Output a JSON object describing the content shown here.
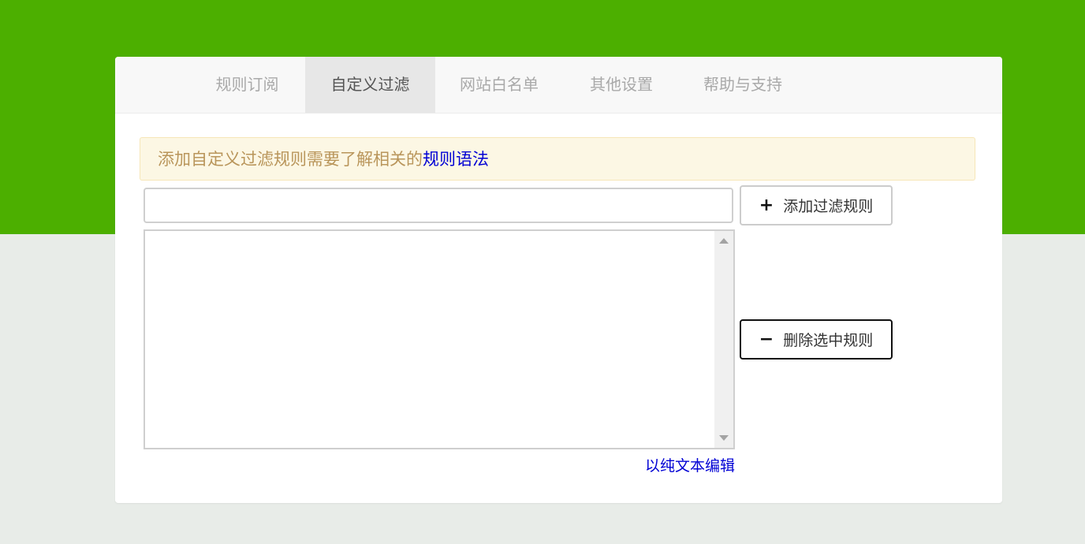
{
  "colors": {
    "header_band": "#4caf00",
    "page_background": "#e8ece8",
    "tab_active_bg": "#e7e7e7",
    "notice_bg": "#fcf7e4",
    "notice_text": "#b9955a",
    "link": "#0000d4"
  },
  "tabs": [
    {
      "label": "规则订阅",
      "active": false
    },
    {
      "label": "自定义过滤",
      "active": true
    },
    {
      "label": "网站白名单",
      "active": false
    },
    {
      "label": "其他设置",
      "active": false
    },
    {
      "label": "帮助与支持",
      "active": false
    }
  ],
  "notice": {
    "text": "添加自定义过滤规则需要了解相关的",
    "link_text": "规则语法"
  },
  "rule_input": {
    "value": "",
    "placeholder": ""
  },
  "buttons": {
    "add_icon": "plus-icon",
    "add_label": "添加过滤规则",
    "delete_icon": "minus-icon",
    "delete_label": "删除选中规则"
  },
  "rule_list": {
    "items": []
  },
  "plain_text_edit_link": "以纯文本编辑"
}
